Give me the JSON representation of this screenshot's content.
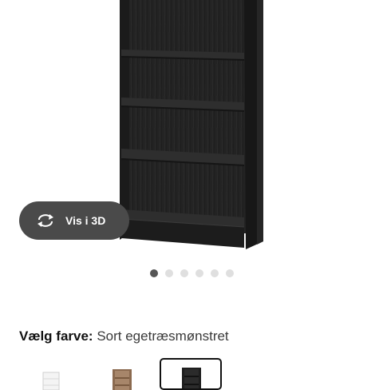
{
  "product_image": {
    "alt": "",
    "view3d_label": "Vis i 3D",
    "view3d_icon": "rotate-3d-icon"
  },
  "carousel": {
    "count": 6,
    "active_index": 0
  },
  "color_selector": {
    "label": "Vælg farve:",
    "value": "Sort egetræsmønstret",
    "options": [
      {
        "name": "white-bookcase-swatch",
        "color": "#f2f2f2",
        "selected": false
      },
      {
        "name": "brown-ash-bookcase-swatch",
        "color": "#8b6a4f",
        "selected": false
      },
      {
        "name": "black-oak-bookcase-swatch",
        "color": "#1e1e1e",
        "selected": true
      }
    ]
  },
  "colors": {
    "button_bg": "#4a4a4a",
    "dot_active": "#555555",
    "dot_inactive": "#dfdfdf",
    "bookcase": "#1f1f1f"
  }
}
